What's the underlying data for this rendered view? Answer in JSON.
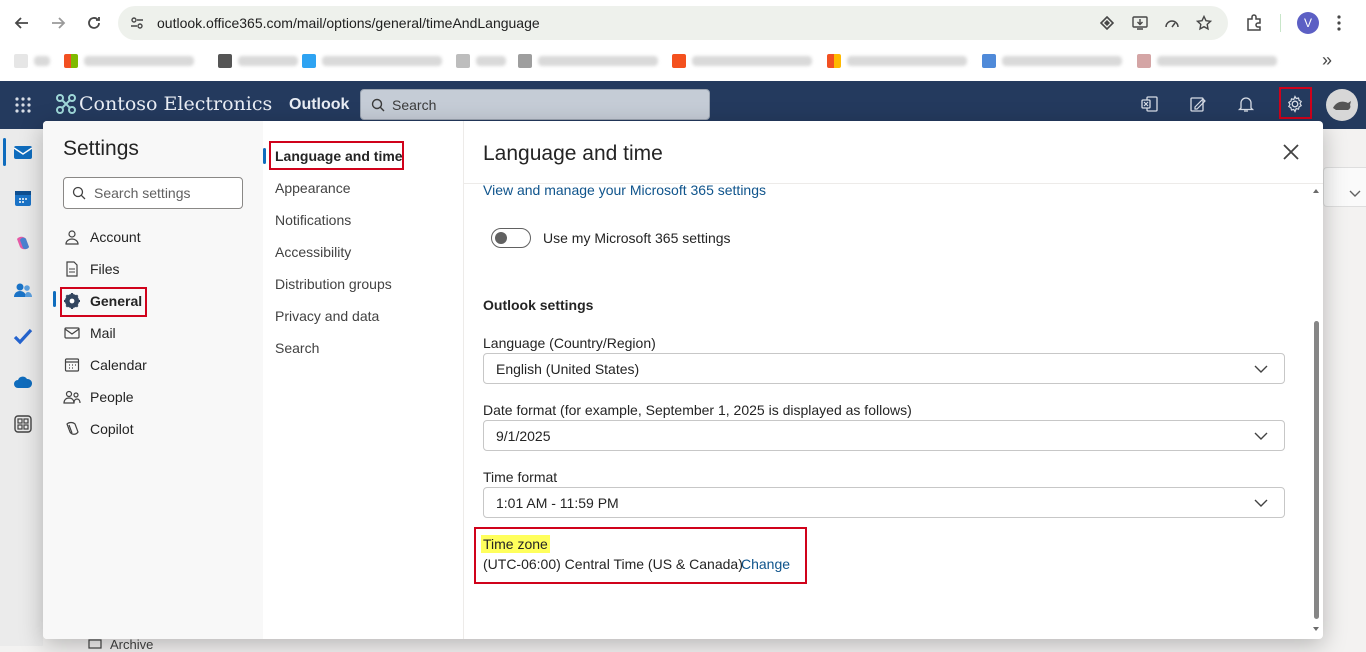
{
  "browser": {
    "url": "outlook.office365.com/mail/options/general/timeAndLanguage",
    "profile_initial": "V",
    "more_bookmarks": "»"
  },
  "header": {
    "brand": "Contoso Electronics",
    "app": "Outlook",
    "search_placeholder": "Search"
  },
  "settings": {
    "title": "Settings",
    "search_placeholder": "Search settings",
    "categories": [
      "Account",
      "Files",
      "General",
      "Mail",
      "Calendar",
      "People",
      "Copilot"
    ],
    "subcategories": [
      "Language and time",
      "Appearance",
      "Notifications",
      "Accessibility",
      "Distribution groups",
      "Privacy and data",
      "Search"
    ]
  },
  "page": {
    "title": "Language and time",
    "m365_link": "View and manage your Microsoft 365 settings",
    "m365_toggle_label": "Use my Microsoft 365 settings",
    "m365_toggle_on": false,
    "section": "Outlook settings",
    "language_label": "Language (Country/Region)",
    "language_value": "English (United States)",
    "date_label": "Date format (for example, September 1, 2025 is displayed as follows)",
    "date_value": "9/1/2025",
    "time_label": "Time format",
    "time_value": "1:01 AM - 11:59 PM",
    "tz_label": "Time zone",
    "tz_value": "(UTC-06:00) Central Time (US & Canada)",
    "tz_change": "Change"
  },
  "background": {
    "archive_label": "Archive"
  },
  "colors": {
    "header_bg": "#243a5e",
    "highlight_box": "#d0021b",
    "tz_highlight": "#ffff5c",
    "link": "#0f548c"
  }
}
